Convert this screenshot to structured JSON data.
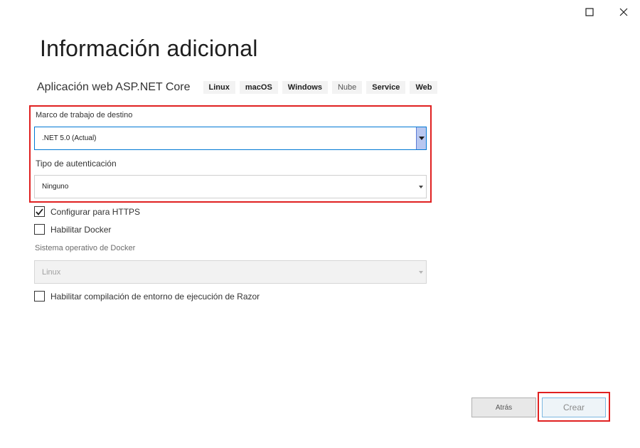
{
  "window": {
    "maximize_icon": "maximize-icon",
    "close_icon": "close-icon"
  },
  "header": {
    "title": "Información adicional",
    "template_name": "Aplicación web ASP.NET Core",
    "tags": [
      "Linux",
      "macOS",
      "Windows",
      "Nube",
      "Service",
      "Web"
    ]
  },
  "form": {
    "framework": {
      "label": "Marco de trabajo de destino",
      "value": ".NET 5.0 (Actual)"
    },
    "auth": {
      "label": "Tipo de autenticación",
      "value": "Ninguno"
    },
    "https": {
      "label": "Configurar para HTTPS",
      "checked": true
    },
    "docker": {
      "label": "Habilitar Docker",
      "checked": false
    },
    "docker_os": {
      "label": "Sistema operativo de Docker",
      "value": "Linux",
      "disabled": true
    },
    "razor": {
      "label": "Habilitar compilación de entorno de ejecución de Razor",
      "checked": false
    }
  },
  "footer": {
    "back_label": "Atrás",
    "create_label": "Crear"
  },
  "colors": {
    "highlight": "#e02020",
    "focus_border": "#0078d4"
  }
}
